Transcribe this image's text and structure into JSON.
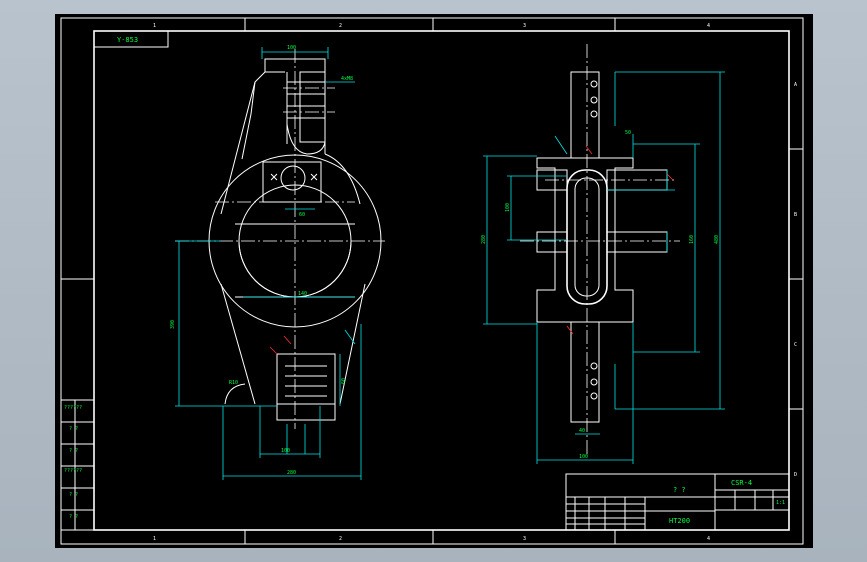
{
  "drawing": {
    "part_label": "Y-853",
    "zone_numbers_top": [
      "1",
      "2",
      "3",
      "4"
    ],
    "zone_numbers_bottom": [
      "1",
      "2",
      "3",
      "4"
    ],
    "zone_letters_right": [
      "A",
      "B",
      "C",
      "D"
    ]
  },
  "title_block": {
    "drawing_number": "CSR-4",
    "part_name": "? ?",
    "material": "HT200",
    "scale": "1:1"
  },
  "left_stamp": {
    "cells": [
      "??????",
      "? ?",
      "? ?",
      "??????",
      "? ?",
      "? ?"
    ]
  },
  "front_view_dims": {
    "top_width": "100",
    "inner_width_1": "60",
    "bore_width": "140",
    "overall_height": "390",
    "bottom_width": "280",
    "lower_slot": "100",
    "radius_label": "R10",
    "thread_label": "4xM8",
    "side_h": "60"
  },
  "side_view_dims": {
    "overall_height": "480",
    "flange_dia": "280",
    "hub_dia": "160",
    "bore_dia": "100",
    "base_width": "100",
    "width_small": "40",
    "top_dim": "50"
  },
  "colors": {
    "background": "#000000",
    "outline": "#ffffff",
    "dimension": "#00e5e5",
    "text": "#00ff40",
    "mark": "#ff3030"
  }
}
